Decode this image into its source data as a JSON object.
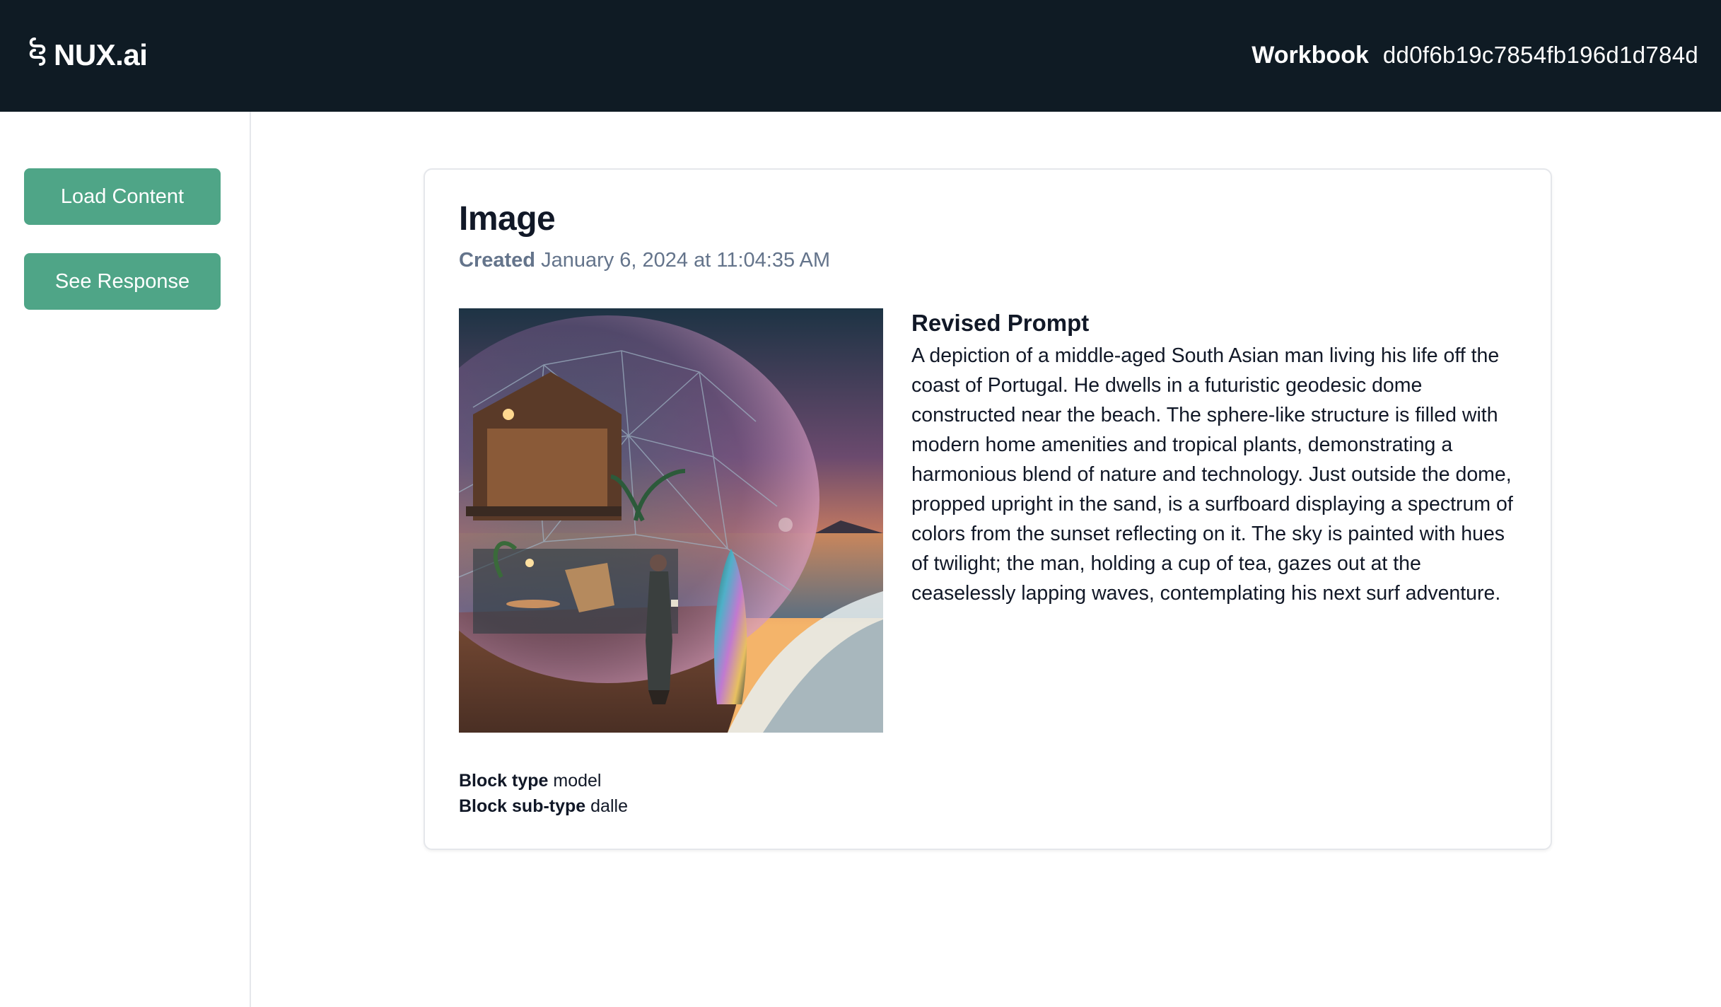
{
  "header": {
    "logo_icon": "chain-link-icon",
    "logo_text": "NUX.ai",
    "workbook_label": "Workbook",
    "workbook_id": "dd0f6b19c7854fb196d1d784d"
  },
  "sidebar": {
    "load_label": "Load Content",
    "response_label": "See Response"
  },
  "card": {
    "title": "Image",
    "created_label": "Created",
    "created_value": "January 6, 2024 at 11:04:35 AM",
    "prompt_title": "Revised Prompt",
    "prompt_text": "A depiction of a middle-aged South Asian man living his life off the coast of Portugal. He dwells in a futuristic geodesic dome constructed near the beach. The sphere-like structure is filled with modern home amenities and tropical plants, demonstrating a harmonious blend of nature and technology. Just outside the dome, propped upright in the sand, is a surfboard displaying a spectrum of colors from the sunset reflecting on it. The sky is painted with hues of twilight; the man, holding a cup of tea, gazes out at the ceaselessly lapping waves, contemplating his next surf adventure.",
    "block_type_label": "Block type",
    "block_type_value": "model",
    "block_subtype_label": "Block sub-type",
    "block_subtype_value": "dalle"
  },
  "colors": {
    "header_bg": "#0f1b24",
    "button_bg": "#4fa587",
    "muted_text": "#64748b"
  }
}
